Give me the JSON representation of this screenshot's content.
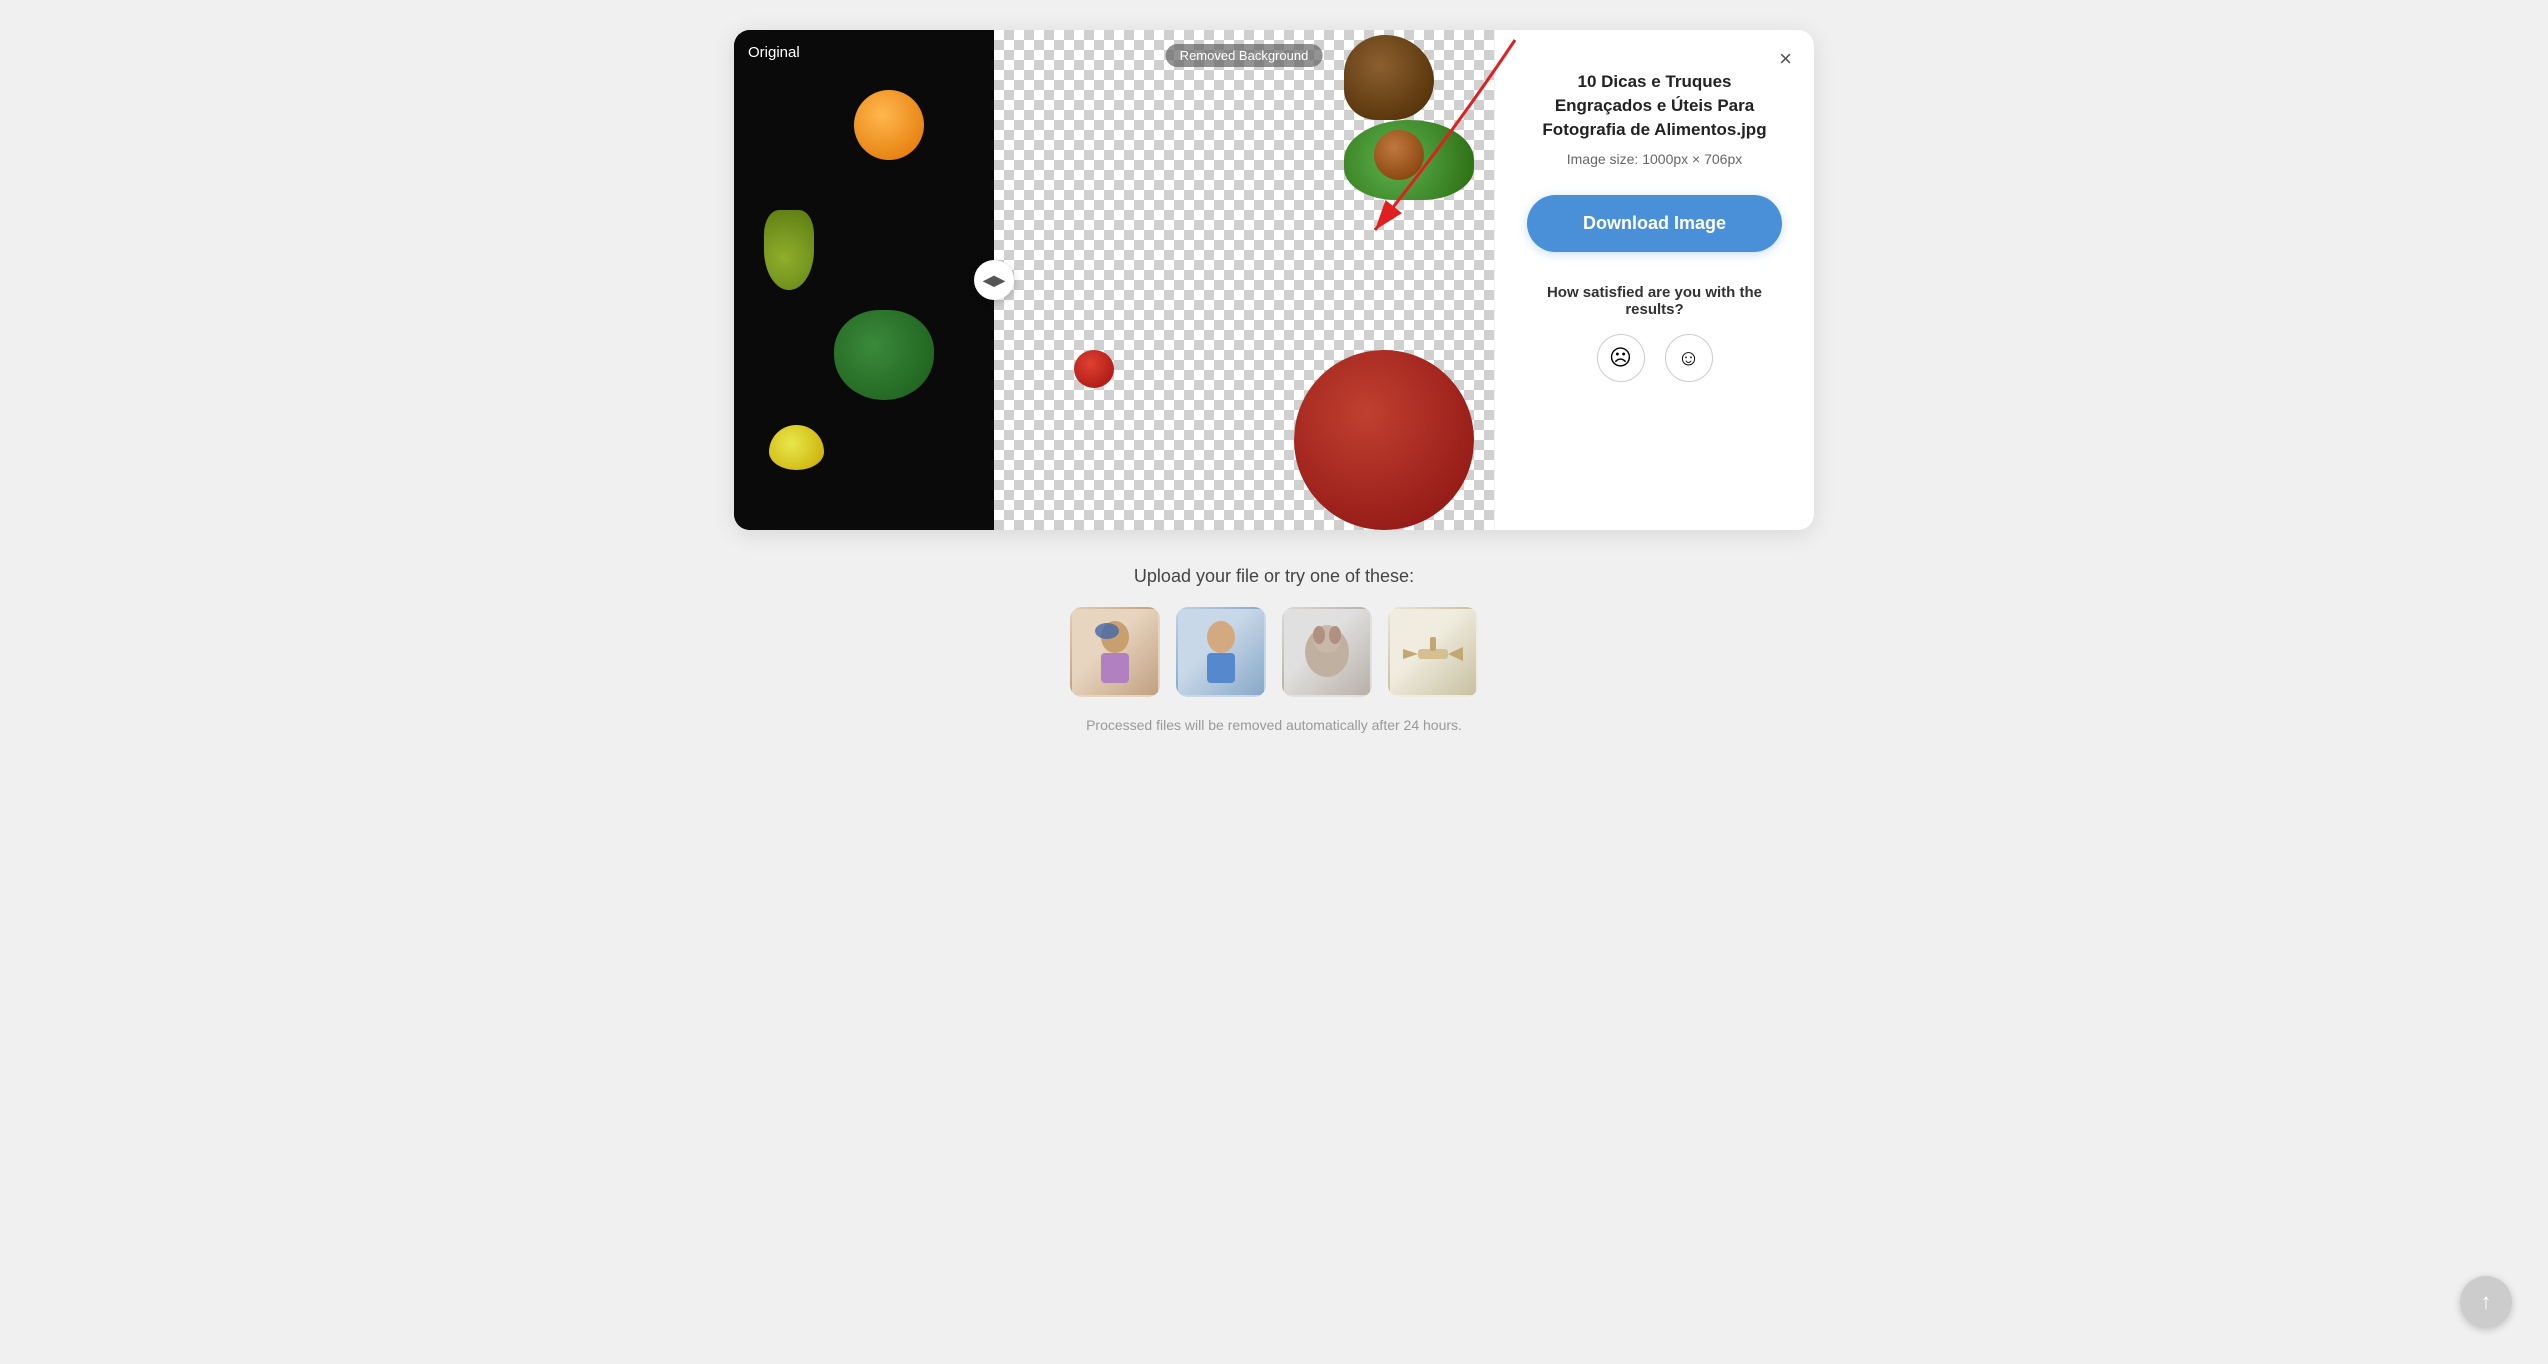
{
  "card": {
    "close_label": "×",
    "original_label": "Original",
    "removed_label": "Removed Background"
  },
  "info_panel": {
    "file_title": "10 Dicas e Truques Engraçados e Úteis Para Fotografia de Alimentos.jpg",
    "image_size": "Image size: 1000px × 706px",
    "download_button_label": "Download Image",
    "satisfaction_label": "How satisfied are you with the results?"
  },
  "bottom": {
    "upload_label": "Upload your file or try one of these:",
    "processed_note": "Processed files will be removed automatically after 24 hours.",
    "sample_images": [
      {
        "alt": "Cyclist with helmet"
      },
      {
        "alt": "Man in denim jacket"
      },
      {
        "alt": "Dog with accessories"
      },
      {
        "alt": "Toy airplane"
      }
    ]
  },
  "scroll_top": {
    "label": "↑"
  },
  "icons": {
    "close": "×",
    "arrow_left": "◀",
    "arrow_right": "▶",
    "face_sad": "☹",
    "face_happy": "☺",
    "scroll_up": "↑"
  }
}
